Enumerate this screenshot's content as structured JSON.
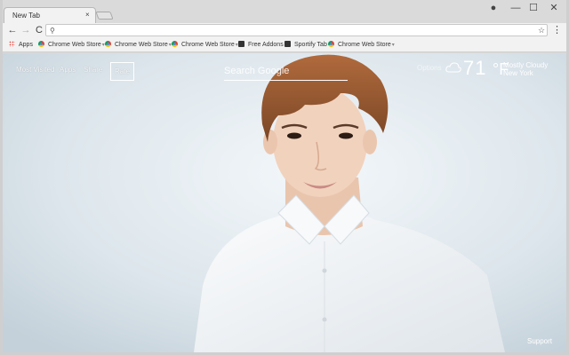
{
  "tab": {
    "title": "New Tab",
    "close": "×"
  },
  "window": {
    "profile": "●",
    "minimize": "—",
    "maximize": "☐",
    "close": "✕"
  },
  "toolbar": {
    "back": "←",
    "forward": "→",
    "reload": "C",
    "star": "☆",
    "menu": "⋮",
    "search_glyph": "⚲"
  },
  "bookmarks": [
    {
      "label": "Apps",
      "icon": "apps-grid-icon"
    },
    {
      "label": "Chrome Web Store",
      "icon": "chrome-web-store-icon",
      "caret": true
    },
    {
      "label": "Chrome Web Store",
      "icon": "chrome-web-store-icon",
      "caret": true
    },
    {
      "label": "Chrome Web Store",
      "icon": "chrome-web-store-icon",
      "caret": true
    },
    {
      "label": "Free Addons",
      "icon": "dark-square-icon"
    },
    {
      "label": "Sportify Tab",
      "icon": "dark-square-icon"
    },
    {
      "label": "Chrome Web Store",
      "icon": "chrome-web-store-icon",
      "caret": true
    }
  ],
  "page": {
    "nav": {
      "most_visited": "Most Visited",
      "apps": "Apps",
      "share": "Share",
      "rate": "Rate"
    },
    "search": {
      "placeholder": "Search Google"
    },
    "options": "Options",
    "weather": {
      "temperature": "71",
      "unit": "°F",
      "condition": "Mostly Cloudy",
      "location": "New York"
    },
    "support": "Support"
  },
  "colors": {
    "chrome_frame": "#dadada",
    "toolbar": "#f2f2f2",
    "background": "#dfe8ee"
  }
}
